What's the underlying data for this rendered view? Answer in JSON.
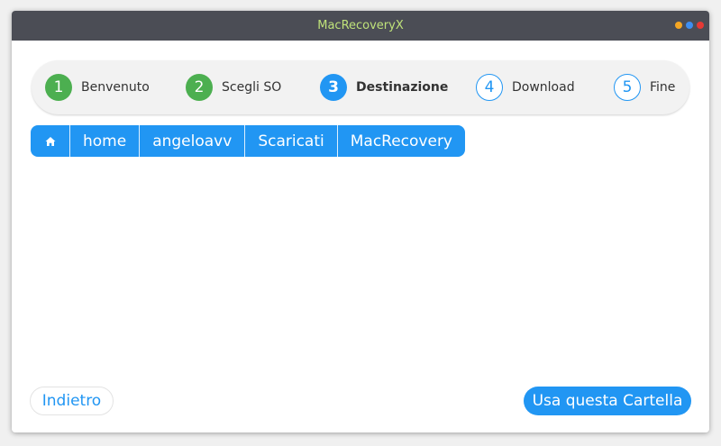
{
  "window": {
    "title": "MacRecoveryX",
    "controls": [
      {
        "name": "minimize",
        "color": "#f5a623"
      },
      {
        "name": "maximize",
        "color": "#3d8ef0"
      },
      {
        "name": "close",
        "color": "#e53935"
      }
    ]
  },
  "colors": {
    "accent": "#2196f3",
    "success": "#4caf50",
    "titlebar": "#4b4d55",
    "title_text": "#bfe27a"
  },
  "steps": [
    {
      "number": "1",
      "label": "Benvenuto",
      "state": "done"
    },
    {
      "number": "2",
      "label": "Scegli SO",
      "state": "done"
    },
    {
      "number": "3",
      "label": "Destinazione",
      "state": "active"
    },
    {
      "number": "4",
      "label": "Download",
      "state": "pending"
    },
    {
      "number": "5",
      "label": "Fine",
      "state": "pending"
    }
  ],
  "breadcrumb": {
    "home_icon": "home-icon",
    "items": [
      "home",
      "angeloavv",
      "Scaricati",
      "MacRecovery"
    ]
  },
  "footer": {
    "back_label": "Indietro",
    "confirm_label": "Usa questa Cartella"
  }
}
